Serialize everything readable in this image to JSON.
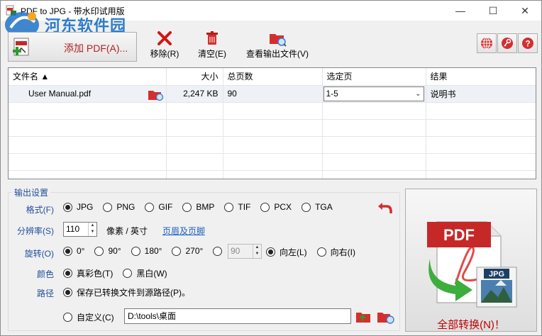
{
  "window": {
    "title": "PDF to JPG - 带水印试用版",
    "min": "—",
    "max": "☐",
    "close": "✕"
  },
  "watermark": {
    "text": "河东软件园",
    "url": "www.pc0359.cn"
  },
  "toolbar": {
    "add_pdf": "添加 PDF(A)...",
    "remove": "移除(R)",
    "clear": "清空(E)",
    "view_output": "查看输出文件(V)"
  },
  "table": {
    "headers": [
      "文件名 ▲",
      "大小",
      "总页数",
      "选定页",
      "结果"
    ],
    "rows": [
      {
        "name": "User Manual.pdf",
        "size": "2,247 KB",
        "pages": "90",
        "selected": "1-5",
        "result": "说明书"
      }
    ]
  },
  "settings": {
    "group_title": "输出设置",
    "format_label": "格式(F)",
    "formats": [
      "JPG",
      "PNG",
      "GIF",
      "BMP",
      "TIF",
      "PCX",
      "TGA"
    ],
    "format_selected": "JPG",
    "dpi_label": "分辨率(S)",
    "dpi_value": "110",
    "dpi_unit": "像素 / 英寸",
    "header_footer_link": "页眉及页脚",
    "rotate_label": "旋转(O)",
    "rotations": [
      "0°",
      "90°",
      "180°",
      "270°"
    ],
    "rotate_custom_value": "90",
    "rotate_left": "向左(L)",
    "rotate_right": "向右(I)",
    "color_label": "颜色",
    "color_options": [
      "真彩色(T)",
      "黑白(W)"
    ],
    "path_label": "路径",
    "path_source": "保存已转换文件到源路径(P)。",
    "path_custom": "自定义(C)",
    "path_value": "D:\\tools\\桌面"
  },
  "convert": {
    "pdf_badge": "PDF",
    "jpg_badge": "JPG",
    "label": "全部转换(N)！"
  },
  "colors": {
    "label_blue": "#1f4e9c",
    "convert_red": "#c00000",
    "watermark_blue": "#1e73c8"
  }
}
